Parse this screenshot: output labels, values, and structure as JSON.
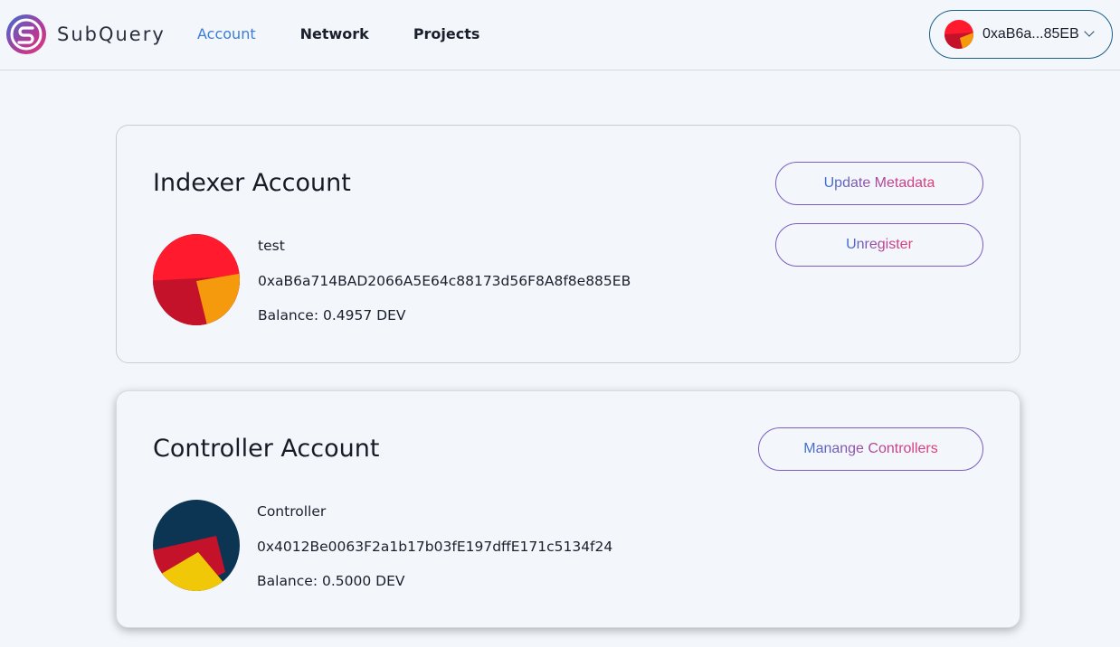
{
  "app": {
    "name": "SubQuery"
  },
  "nav": {
    "items": [
      "Account",
      "Network",
      "Projects"
    ],
    "active": "Account"
  },
  "wallet": {
    "address_short": "0xaB6a...85EB"
  },
  "indexer": {
    "title": "Indexer Account",
    "name": "test",
    "address": "0xaB6a714BAD2066A5E64c88173d56F8A8f8e885EB",
    "balance": "Balance: 0.4957 DEV",
    "update_label": "Update Metadata",
    "unregister_label": "Unregister"
  },
  "controller": {
    "title": "Controller Account",
    "name": "Controller",
    "address": "0x4012Be0063F2a1b17b03fE197dffE171c5134f24",
    "balance": "Balance: 0.5000 DEV",
    "manage_label": "Manange Controllers"
  },
  "icons": {
    "logo": "subquery-logo-icon",
    "wallet_chevron": "chevron-down-icon",
    "indexer_avatar": "identicon",
    "controller_avatar": "identicon"
  },
  "colors": {
    "accent": "#3b7dd8",
    "gradient_start": "#3b6fd4",
    "gradient_end": "#e23a7a",
    "indexer_identicon": [
      "#ff1a2e",
      "#c4122a",
      "#f59a0c",
      "#0b3553"
    ],
    "controller_identicon": [
      "#0b3553",
      "#c4122a",
      "#f0c808"
    ]
  }
}
